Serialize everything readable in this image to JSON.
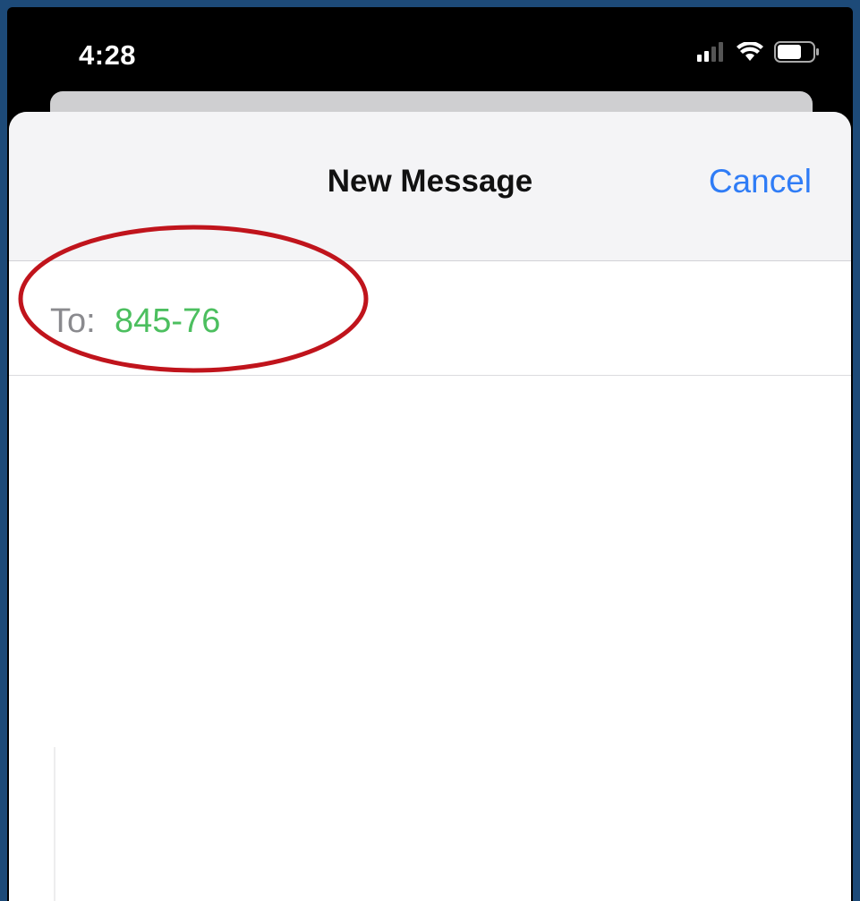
{
  "status_bar": {
    "time": "4:28",
    "icons": [
      "signal-icon",
      "wifi-icon",
      "battery-icon"
    ]
  },
  "nav": {
    "title": "New Message",
    "cancel_label": "Cancel"
  },
  "recipient": {
    "label": "To:",
    "value": "845-76"
  },
  "colors": {
    "background": "#1d4a78",
    "accent_blue": "#2f7cf6",
    "recipient_green": "#4cbf5f",
    "annotation_red": "#c0141c"
  }
}
